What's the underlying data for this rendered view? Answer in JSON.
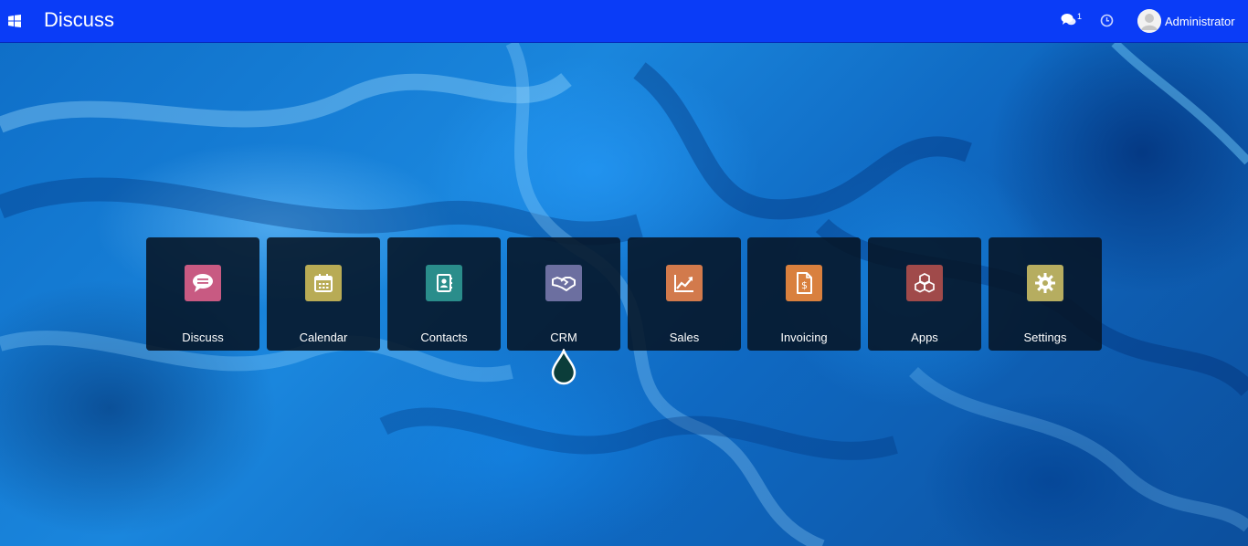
{
  "header": {
    "title": "Discuss",
    "messages_count": "1",
    "user_name": "Administrator"
  },
  "colors": {
    "topbar": "#0a3cf7",
    "tile_bg": "#06142a"
  },
  "apps": [
    {
      "label": "Discuss",
      "icon": "chat-bubble-icon",
      "color": "#c85a82"
    },
    {
      "label": "Calendar",
      "icon": "calendar-icon",
      "color": "#b8ab55"
    },
    {
      "label": "Contacts",
      "icon": "address-book-icon",
      "color": "#2a8d8b"
    },
    {
      "label": "CRM",
      "icon": "handshake-icon",
      "color": "#6c6fa0"
    },
    {
      "label": "Sales",
      "icon": "chart-line-icon",
      "color": "#d27a4c"
    },
    {
      "label": "Invoicing",
      "icon": "invoice-icon",
      "color": "#d9803e"
    },
    {
      "label": "Apps",
      "icon": "cubes-icon",
      "color": "#a04a4a"
    },
    {
      "label": "Settings",
      "icon": "gear-icon",
      "color": "#b6ad60"
    }
  ]
}
